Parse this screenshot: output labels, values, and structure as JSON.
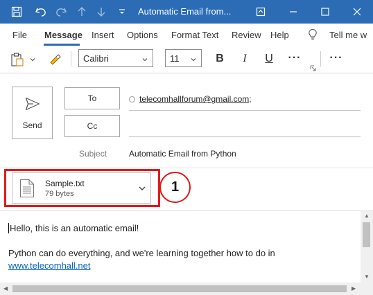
{
  "window": {
    "title": "Automatic Email from...",
    "minimize_label": "Minimize",
    "maximize_label": "Maximize",
    "close_label": "Close"
  },
  "menu": {
    "tabs": [
      "File",
      "Message",
      "Insert",
      "Options",
      "Format Text",
      "Review",
      "Help"
    ],
    "active_tab": "Message",
    "tell_me": "Tell me w"
  },
  "ribbon": {
    "font_name": "Calibri",
    "font_size": "11",
    "bold": "B",
    "italic": "I",
    "underline": "U",
    "more": "···"
  },
  "header": {
    "send_label": "Send",
    "to_label": "To",
    "cc_label": "Cc",
    "to_value": "telecomhallforum@gmail.com;",
    "subject_label": "Subject",
    "subject_value": "Automatic Email from Python"
  },
  "attachment": {
    "name": "Sample.txt",
    "size": "79 bytes",
    "callout_number": "1"
  },
  "body": {
    "line1": "Hello, this is an automatic email!",
    "line2": "Python can do everything, and we're learning together how to do in",
    "link": "www.telecomhall.net"
  },
  "colors": {
    "title_bar": "#2b6cb5",
    "highlight_red": "#e21a1a",
    "link_blue": "#0563c1"
  }
}
